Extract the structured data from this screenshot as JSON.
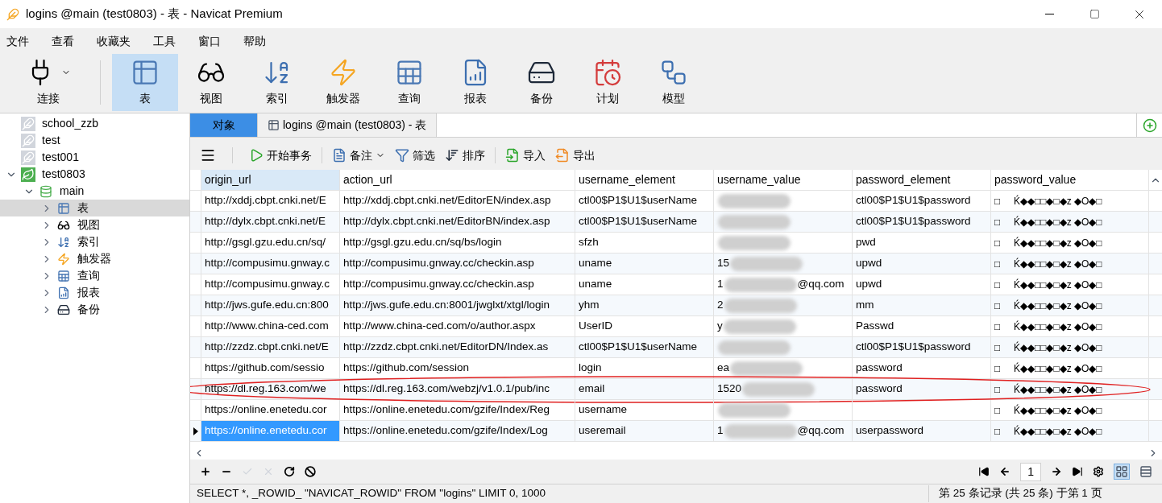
{
  "window": {
    "title": "logins @main (test0803) - 表 - Navicat Premium"
  },
  "menu": [
    "文件",
    "查看",
    "收藏夹",
    "工具",
    "窗口",
    "帮助"
  ],
  "toolbar": [
    {
      "kind": "connect",
      "label": "连接",
      "selected": false
    },
    {
      "kind": "table",
      "label": "表",
      "selected": true
    },
    {
      "kind": "view",
      "label": "视图",
      "selected": false
    },
    {
      "kind": "index",
      "label": "索引",
      "selected": false
    },
    {
      "kind": "trigger",
      "label": "触发器",
      "selected": false
    },
    {
      "kind": "query",
      "label": "查询",
      "selected": false
    },
    {
      "kind": "report",
      "label": "报表",
      "selected": false
    },
    {
      "kind": "backup",
      "label": "备份",
      "selected": false
    },
    {
      "kind": "schedule",
      "label": "计划",
      "selected": false
    },
    {
      "kind": "model",
      "label": "模型",
      "selected": false
    }
  ],
  "sidebar": {
    "items": [
      {
        "kind": "connection",
        "label": "school_zzb",
        "open": false
      },
      {
        "kind": "connection",
        "label": "test",
        "open": false
      },
      {
        "kind": "connection",
        "label": "test001",
        "open": false
      },
      {
        "kind": "connection",
        "label": "test0803",
        "open": true,
        "expanded": true,
        "children": [
          {
            "kind": "database",
            "label": "main",
            "expanded": true,
            "children": [
              {
                "kind": "table",
                "label": "表",
                "expanded": false,
                "selected": true
              },
              {
                "kind": "view",
                "label": "视图",
                "expanded": false,
                "selected": false
              },
              {
                "kind": "index",
                "label": "索引",
                "expanded": false,
                "selected": false
              },
              {
                "kind": "trigger",
                "label": "触发器",
                "expanded": false,
                "selected": false
              },
              {
                "kind": "query",
                "label": "查询",
                "expanded": false,
                "selected": false
              },
              {
                "kind": "report",
                "label": "报表",
                "expanded": false,
                "selected": false
              },
              {
                "kind": "backup",
                "label": "备份",
                "expanded": false,
                "selected": false
              }
            ]
          }
        ]
      }
    ]
  },
  "tabs": [
    {
      "kind": "objects",
      "label": "对象",
      "selected": true
    },
    {
      "kind": "table",
      "label": "logins @main (test0803) - 表",
      "selected": false
    }
  ],
  "data_toolbar": [
    {
      "kind": "menu"
    },
    {
      "kind": "transaction",
      "label": "开始事务"
    },
    {
      "kind": "memo",
      "label": "备注"
    },
    {
      "kind": "filter",
      "label": "筛选"
    },
    {
      "kind": "sort",
      "label": "排序"
    },
    {
      "kind": "import",
      "label": "导入"
    },
    {
      "kind": "export",
      "label": "导出"
    }
  ],
  "table": {
    "columns": [
      "origin_url",
      "action_url",
      "username_element",
      "username_value",
      "password_element",
      "password_value"
    ],
    "rows": [
      {
        "cells": [
          "http://xddj.cbpt.cnki.net/E",
          "http://xddj.cbpt.cnki.net/EditorEN/index.asp",
          "ctl00$P1$U1$userName",
          {},
          "ctl00$P1$U1$password",
          "□     Ḱ◆◆□□◆□◆z ◆O◆□"
        ],
        "current": false,
        "circled": false
      },
      {
        "cells": [
          "http://dylx.cbpt.cnki.net/E",
          "http://dylx.cbpt.cnki.net/EditorBN/index.asp",
          "ctl00$P1$U1$userName",
          {},
          "ctl00$P1$U1$password",
          "□     Ḱ◆◆□□◆□◆z ◆O◆□"
        ],
        "current": false,
        "circled": false
      },
      {
        "cells": [
          "http://gsgl.gzu.edu.cn/sq/",
          "http://gsgl.gzu.edu.cn/sq/bs/login",
          "sfzh",
          {},
          "pwd",
          "□     Ḱ◆◆□□◆□◆z ◆O◆□"
        ],
        "current": false,
        "circled": false
      },
      {
        "cells": [
          "http://compusimu.gnway.c",
          "http://compusimu.gnway.cc/checkin.asp",
          "uname",
          {
            "prefix": "15"
          },
          "upwd",
          "□     Ḱ◆◆□□◆□◆z ◆O◆□"
        ],
        "current": false,
        "circled": false
      },
      {
        "cells": [
          "http://compusimu.gnway.c",
          "http://compusimu.gnway.cc/checkin.asp",
          "uname",
          {
            "prefix": "1",
            "suffix": "@qq.com"
          },
          "upwd",
          "□     Ḱ◆◆□□◆□◆z ◆O◆□"
        ],
        "current": false,
        "circled": false
      },
      {
        "cells": [
          "http://jws.gufe.edu.cn:800",
          "http://jws.gufe.edu.cn:8001/jwglxt/xtgl/login",
          "yhm",
          {
            "prefix": "2"
          },
          "mm",
          "□     Ḱ◆◆□□◆□◆z ◆O◆□"
        ],
        "current": false,
        "circled": false
      },
      {
        "cells": [
          "http://www.china-ced.com",
          "http://www.china-ced.com/o/author.aspx",
          "UserID",
          {
            "prefix": "y"
          },
          "Passwd",
          "□     Ḱ◆◆□□◆□◆z ◆O◆□"
        ],
        "current": false,
        "circled": false
      },
      {
        "cells": [
          "http://zzdz.cbpt.cnki.net/E",
          "http://zzdz.cbpt.cnki.net/EditorDN/Index.as",
          "ctl00$P1$U1$userName",
          {},
          "ctl00$P1$U1$password",
          "□     Ḱ◆◆□□◆□◆z ◆O◆□"
        ],
        "current": false,
        "circled": false
      },
      {
        "cells": [
          "https://github.com/sessio",
          "https://github.com/session",
          "login",
          {
            "prefix": "ea"
          },
          "password",
          "□     Ḱ◆◆□□◆□◆z ◆O◆□"
        ],
        "current": false,
        "circled": false
      },
      {
        "cells": [
          "https://dl.reg.163.com/we",
          "https://dl.reg.163.com/webzj/v1.0.1/pub/inc",
          "email",
          {
            "prefix": "1520"
          },
          "password",
          "□     Ḱ◆◆□□◆□◆z ◆O◆□"
        ],
        "current": false,
        "circled": true
      },
      {
        "cells": [
          "https://online.enetedu.cor",
          "https://online.enetedu.com/gzife/Index/Reg",
          "username",
          {},
          null,
          "□     Ḱ◆◆□□◆□◆z ◆O◆□"
        ],
        "current": false,
        "circled": false
      },
      {
        "cells": [
          "https://online.enetedu.cor",
          "https://online.enetedu.com/gzife/Index/Log",
          "useremail",
          {
            "prefix": "1",
            "suffix": "@qq.com"
          },
          "userpassword",
          "□     Ḱ◆◆□□◆□◆z ◆O◆□"
        ],
        "current": true,
        "circled": false
      }
    ]
  },
  "pager": {
    "page": "1"
  },
  "status_bar": {
    "sql": "SELECT *, _ROWID_ \"NAVICAT_ROWID\" FROM \"logins\" LIMIT 0, 1000",
    "record": "第 25 条记录 (共 25 条) 于第 1 页"
  }
}
